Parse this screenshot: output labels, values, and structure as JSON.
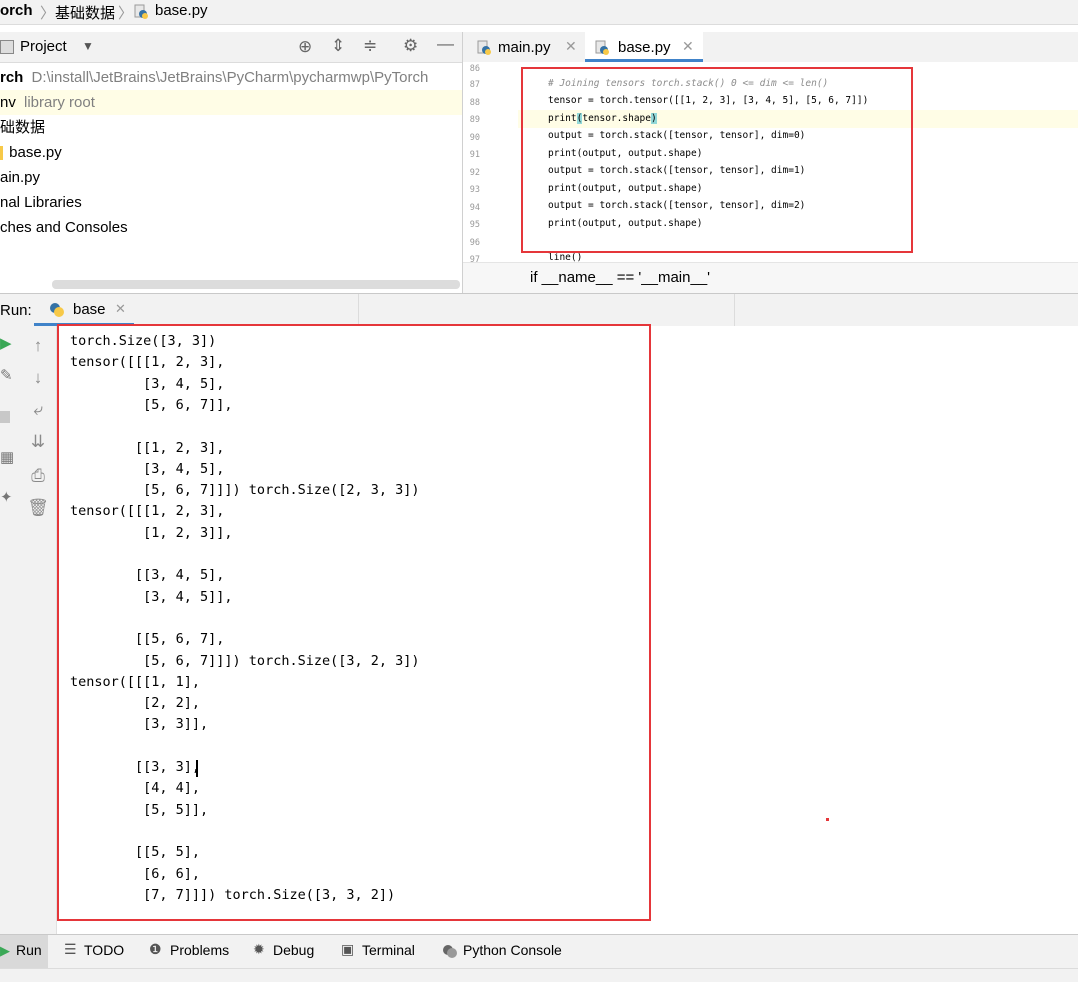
{
  "breadcrumb": {
    "project": "orch",
    "folder": "基础数据",
    "file": "base.py"
  },
  "project_panel": {
    "view_label": "Project",
    "tree": [
      {
        "name": "rch",
        "path": "D:\\install\\JetBrains\\JetBrains\\PyCharm\\pycharmwp\\PyTorch"
      },
      {
        "name": "nv",
        "note": "library root"
      },
      {
        "name": "础数据"
      },
      {
        "name": "base.py"
      },
      {
        "name": "ain.py"
      },
      {
        "name": "nal Libraries"
      },
      {
        "name": "ches and Consoles"
      }
    ]
  },
  "editor": {
    "tabs": [
      {
        "label": "main.py",
        "active": false
      },
      {
        "label": "base.py",
        "active": true
      }
    ],
    "line_numbers": [
      "86",
      "87",
      "88",
      "89",
      "90",
      "91",
      "92",
      "93",
      "94",
      "95",
      "96",
      "97"
    ],
    "lines": {
      "l87": "# Joining tensors torch.stack() 0 <= dim <= len()",
      "l88": "tensor = torch.tensor([[1, 2, 3], [3, 4, 5], [5, 6, 7]])",
      "l89": "print(tensor.shape)",
      "l90": "output = torch.stack([tensor, tensor], dim=0)",
      "l91": "print(output, output.shape)",
      "l92": "output = torch.stack([tensor, tensor], dim=1)",
      "l93": "print(output, output.shape)",
      "l94": "output = torch.stack([tensor, tensor], dim=2)",
      "l95": "print(output, output.shape)",
      "l97": "line()"
    },
    "code_breadcrumb": "if __name__ == '__main__'"
  },
  "run": {
    "label": "Run:",
    "tab": "base",
    "output": [
      "torch.Size([3, 3])",
      "tensor([[[1, 2, 3],",
      "         [3, 4, 5],",
      "         [5, 6, 7]],",
      "",
      "        [[1, 2, 3],",
      "         [3, 4, 5],",
      "         [5, 6, 7]]]) torch.Size([2, 3, 3])",
      "tensor([[[1, 2, 3],",
      "         [1, 2, 3]],",
      "",
      "        [[3, 4, 5],",
      "         [3, 4, 5]],",
      "",
      "        [[5, 6, 7],",
      "         [5, 6, 7]]]) torch.Size([3, 2, 3])",
      "tensor([[[1, 1],",
      "         [2, 2],",
      "         [3, 3]],",
      "",
      "        [[3, 3],",
      "         [4, 4],",
      "         [5, 5]],",
      "",
      "        [[5, 5],",
      "         [6, 6],",
      "         [7, 7]]]) torch.Size([3, 3, 2])"
    ]
  },
  "bottom_tabs": [
    {
      "label": "Run",
      "icon": "run-icon"
    },
    {
      "label": "TODO",
      "icon": "todo-icon"
    },
    {
      "label": "Problems",
      "icon": "problems-icon"
    },
    {
      "label": "Debug",
      "icon": "debug-icon"
    },
    {
      "label": "Terminal",
      "icon": "terminal-icon"
    },
    {
      "label": "Python Console",
      "icon": "python-console-icon"
    }
  ],
  "colors": {
    "highlight_box": "#e5363a",
    "python_blue": "#3572a5",
    "python_yellow": "#f7c948"
  }
}
